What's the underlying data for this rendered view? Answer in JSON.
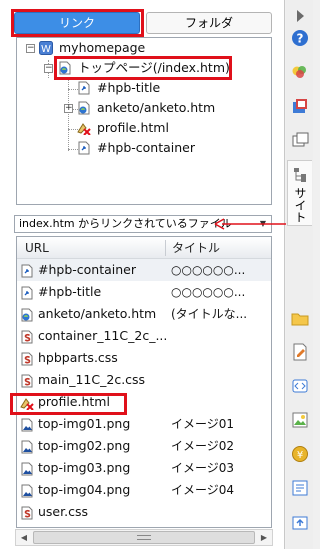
{
  "tabs": {
    "link": "リンク",
    "folder": "フォルダ"
  },
  "tree": {
    "root": "myhomepage",
    "page": "トップページ(/index.htm)",
    "children": [
      {
        "label": "#hpb-title",
        "icon": "page-link-icon"
      },
      {
        "label": "anketo/anketo.htm",
        "icon": "web-page-icon"
      },
      {
        "label": "profile.html",
        "icon": "broken-link-icon"
      },
      {
        "label": "#hpb-container",
        "icon": "page-link-icon"
      }
    ]
  },
  "filter": {
    "selected": "index.htm からリンクされているファイル"
  },
  "list": {
    "headers": {
      "url": "URL",
      "title": "タイトル"
    },
    "rows": [
      {
        "url": "#hpb-container",
        "title": "○○○○○○...",
        "icon": "page-link-icon"
      },
      {
        "url": "#hpb-title",
        "title": "○○○○○○...",
        "icon": "page-link-icon"
      },
      {
        "url": "anketo/anketo.htm",
        "title": "(タイトルな...",
        "icon": "web-page-icon"
      },
      {
        "url": "container_11C_2c_...",
        "title": "",
        "icon": "css-file-icon"
      },
      {
        "url": "hpbparts.css",
        "title": "",
        "icon": "css-file-icon"
      },
      {
        "url": "main_11C_2c.css",
        "title": "",
        "icon": "css-file-icon"
      },
      {
        "url": "profile.html",
        "title": "",
        "icon": "broken-link-icon"
      },
      {
        "url": "top-img01.png",
        "title": "イメージ01",
        "icon": "image-file-icon"
      },
      {
        "url": "top-img02.png",
        "title": "イメージ02",
        "icon": "image-file-icon"
      },
      {
        "url": "top-img03.png",
        "title": "イメージ03",
        "icon": "image-file-icon"
      },
      {
        "url": "top-img04.png",
        "title": "イメージ04",
        "icon": "image-file-icon"
      },
      {
        "url": "user.css",
        "title": "",
        "icon": "css-file-icon"
      }
    ]
  },
  "side_tab": {
    "label": "サイト"
  },
  "colors": {
    "accent": "#3d8ee6",
    "highlight": "#e0101a"
  }
}
